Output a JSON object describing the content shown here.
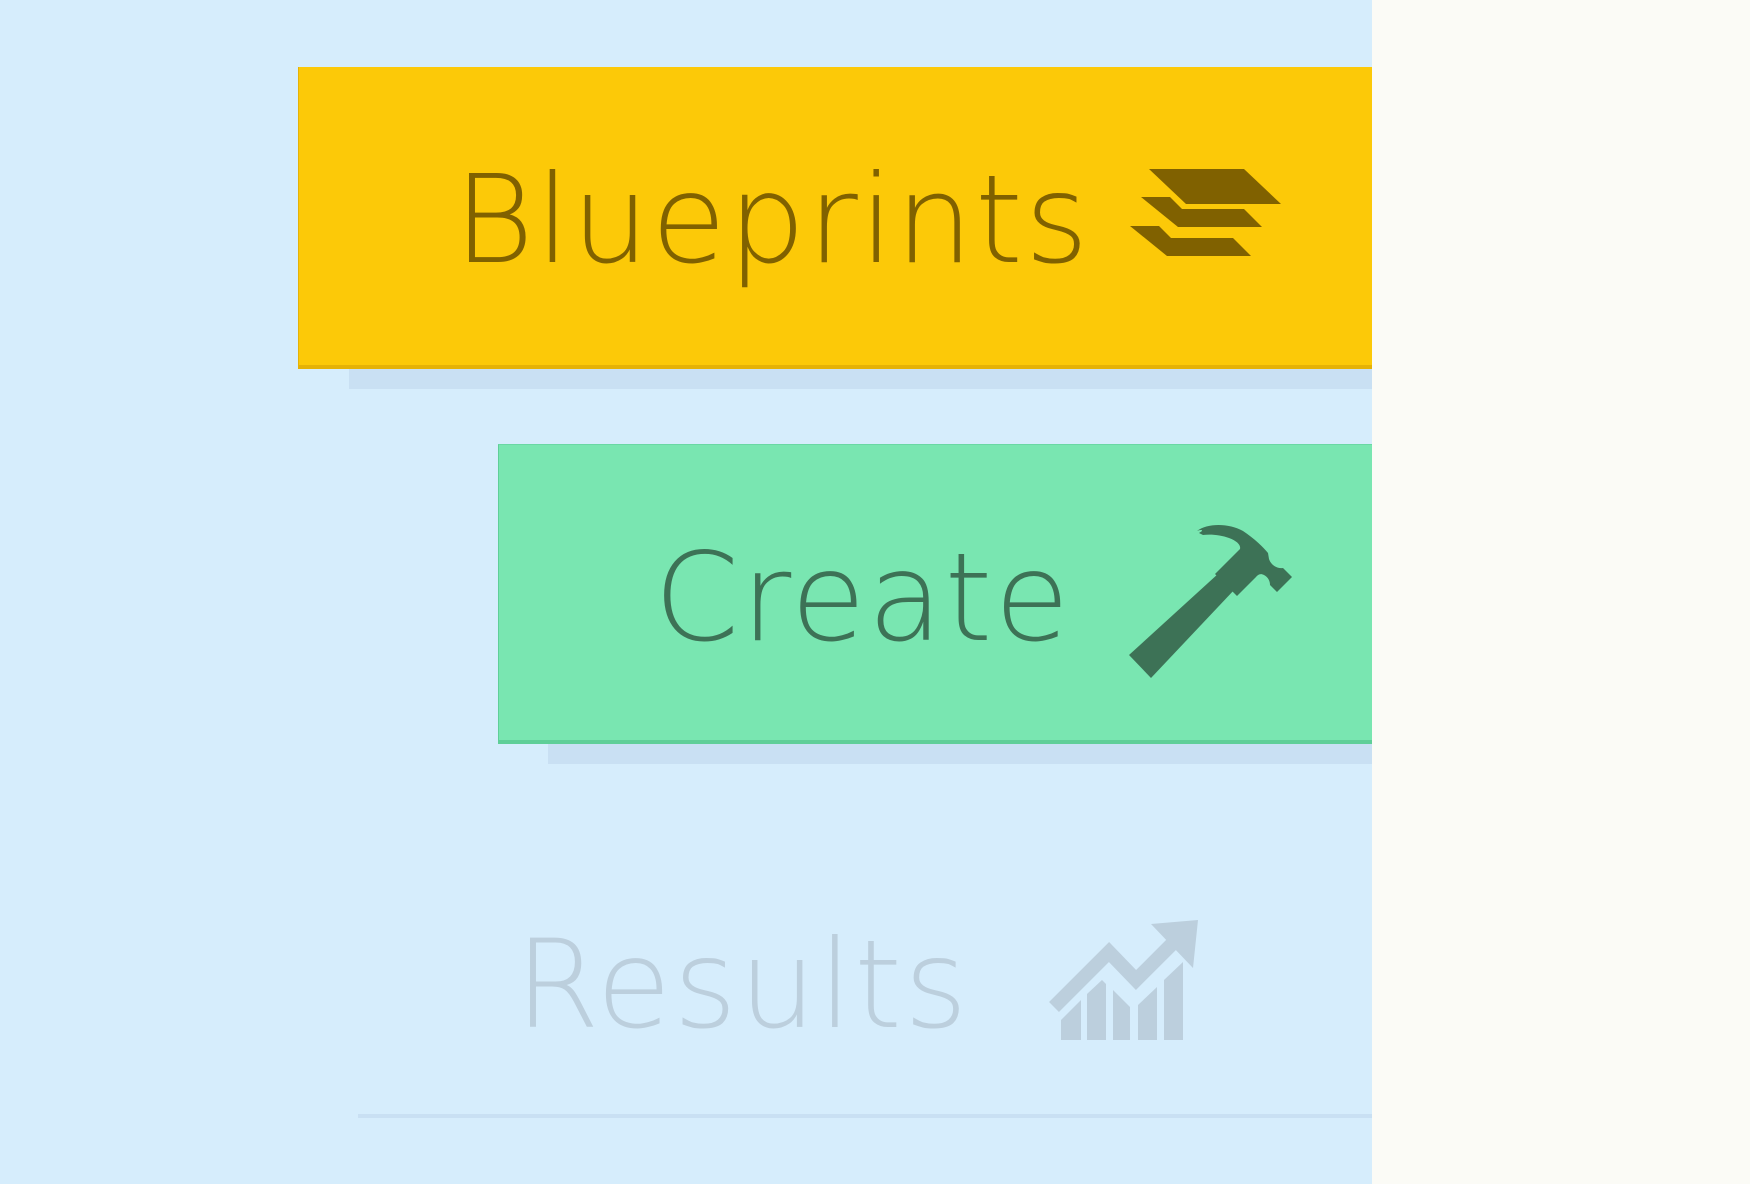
{
  "nav": {
    "items": [
      {
        "label": "Blueprints",
        "icon": "layers-icon",
        "state": "active"
      },
      {
        "label": "Create",
        "icon": "hammer-icon",
        "state": "active"
      },
      {
        "label": "Results",
        "icon": "rising-chart-icon",
        "state": "disabled"
      }
    ]
  },
  "colors": {
    "panel_background": "#d6edfc",
    "right_background": "#fbfbf6",
    "blueprints_fill": "#fcc908",
    "blueprints_text": "#806100",
    "create_fill": "#79e6b1",
    "create_text": "#3d7256",
    "results_text": "#bccfdd"
  }
}
